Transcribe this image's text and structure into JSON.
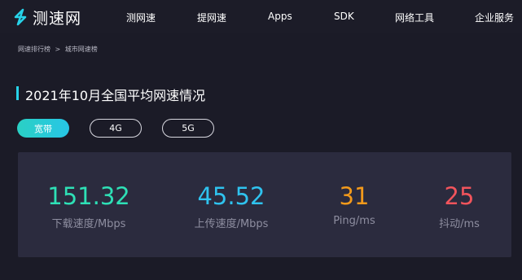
{
  "header": {
    "logo_text": "测速网",
    "nav": [
      "测网速",
      "提网速",
      "Apps",
      "SDK",
      "网络工具",
      "企业服务"
    ]
  },
  "breadcrumb": {
    "items": [
      "网速排行榜",
      "城市网速榜"
    ],
    "separator": ">"
  },
  "page_title": "2021年10月全国平均网速情况",
  "tabs": [
    {
      "label": "宽带",
      "active": true
    },
    {
      "label": "4G",
      "active": false
    },
    {
      "label": "5G",
      "active": false
    }
  ],
  "stats": [
    {
      "value": "151.32",
      "label": "下载速度/Mbps",
      "color": "#2ee0b6"
    },
    {
      "value": "45.52",
      "label": "上传速度/Mbps",
      "color": "#2fc3ef"
    },
    {
      "value": "31",
      "label": "Ping/ms",
      "color": "#f39a1b"
    },
    {
      "value": "25",
      "label": "抖动/ms",
      "color": "#f2545c"
    }
  ],
  "colors": {
    "accent": "#27d2e8",
    "background": "#1b1b27",
    "panel": "#2b2b3e"
  }
}
